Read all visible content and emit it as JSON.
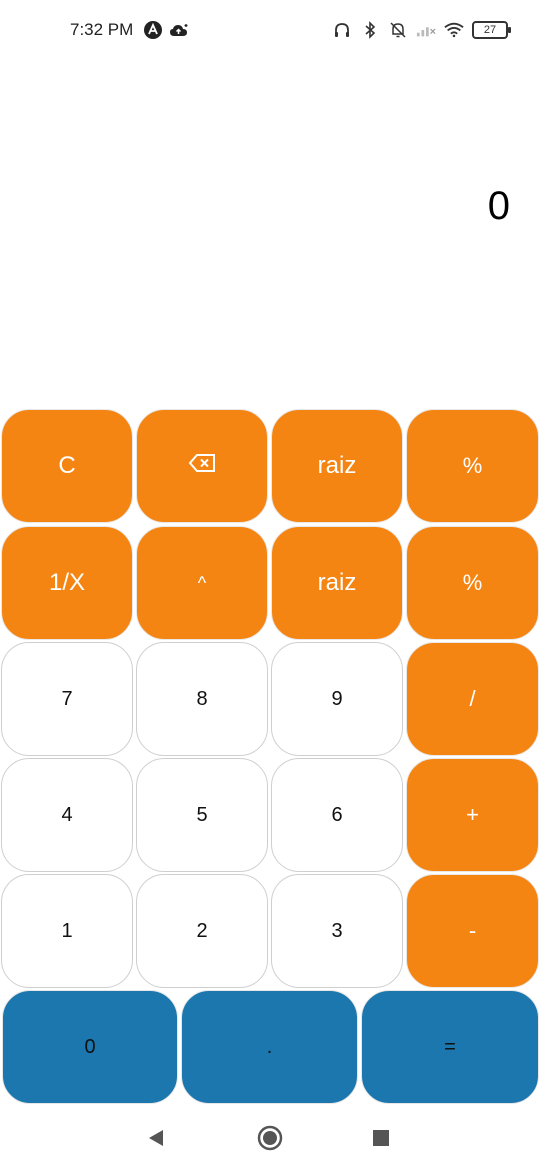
{
  "status_bar": {
    "time": "7:32 PM",
    "battery": "27",
    "left_icons": [
      "app-a-icon",
      "cloud-upload-icon"
    ],
    "right_icons": [
      "headphones-icon",
      "bluetooth-icon",
      "bell-muted-icon",
      "signal-icon",
      "wifi-icon",
      "battery-icon"
    ]
  },
  "display": {
    "value": "0"
  },
  "keypad": {
    "row1": [
      "C",
      "⌫",
      "raiz",
      "%"
    ],
    "row2": [
      "1/X",
      "^",
      "raiz",
      "%"
    ],
    "row3": [
      "7",
      "8",
      "9",
      "/"
    ],
    "row4": [
      "4",
      "5",
      "6",
      "+"
    ],
    "row5": [
      "1",
      "2",
      "3",
      "-"
    ],
    "row6": [
      "0",
      ".",
      "="
    ]
  },
  "colors": {
    "orange": "#F58513",
    "blue": "#1B77AD",
    "white": "#FFFFFF"
  },
  "nav": {
    "icons": [
      "back-icon",
      "home-icon",
      "recents-icon"
    ]
  }
}
